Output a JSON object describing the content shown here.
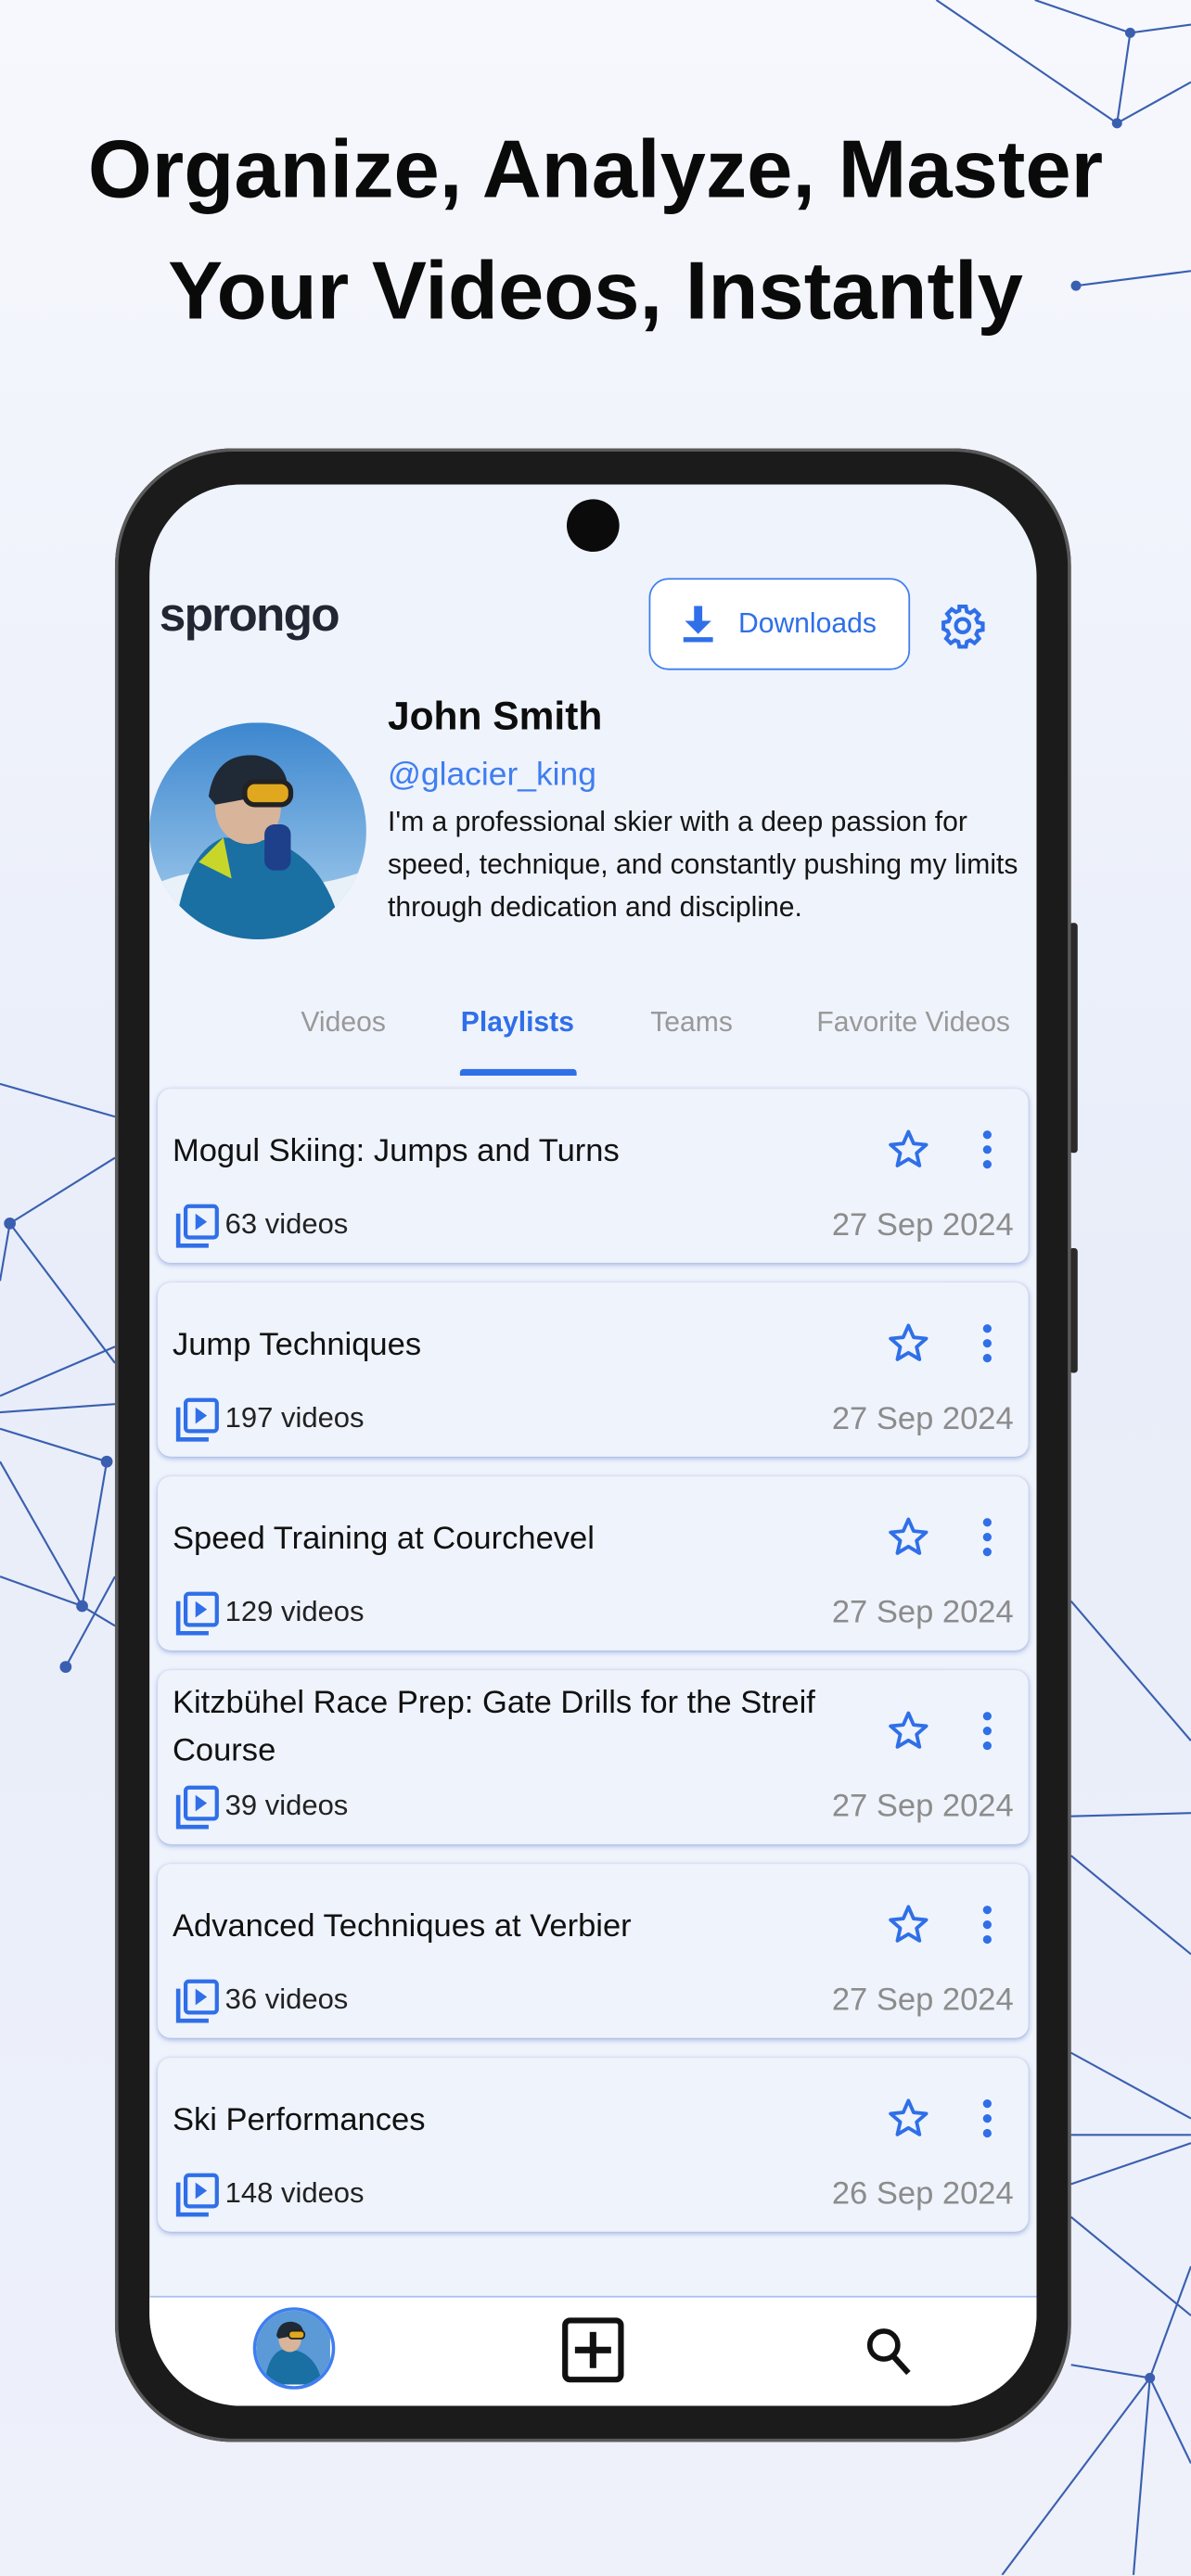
{
  "headline": {
    "line1": "Organize, Analyze, Master",
    "line2": "Your Videos, Instantly"
  },
  "app": {
    "logo_text": "sprongo",
    "downloads_label": "Downloads",
    "accent_color": "#2f6fe8"
  },
  "profile": {
    "name": "John Smith",
    "handle": "@glacier_king",
    "bio": "I'm a professional skier with a deep passion for speed, technique, and constantly pushing my limits through dedication and discipline."
  },
  "tabs": [
    {
      "label": "Videos",
      "active": false
    },
    {
      "label": "Playlists",
      "active": true
    },
    {
      "label": "Teams",
      "active": false
    },
    {
      "label": "Favorite Videos",
      "active": false
    }
  ],
  "playlists": [
    {
      "title": "Mogul Skiing: Jumps and Turns",
      "count": "63 videos",
      "date": "27 Sep 2024"
    },
    {
      "title": "Jump Techniques",
      "count": "197 videos",
      "date": "27 Sep 2024"
    },
    {
      "title": "Speed Training at Courchevel",
      "count": "129 videos",
      "date": "27 Sep 2024"
    },
    {
      "title": "Kitzbühel Race Prep: Gate Drills for the Streif Course",
      "count": "39 videos",
      "date": "27 Sep 2024"
    },
    {
      "title": "Advanced Techniques at Verbier",
      "count": "36 videos",
      "date": "27 Sep 2024"
    },
    {
      "title": "Ski Performances",
      "count": "148 videos",
      "date": "26 Sep 2024"
    }
  ],
  "icons": {
    "download": "download-icon",
    "settings": "gear-icon",
    "favorite": "star-outline-icon",
    "more": "more-vertical-icon",
    "playlist": "video-library-icon",
    "add": "add-box-icon",
    "search": "search-icon"
  }
}
